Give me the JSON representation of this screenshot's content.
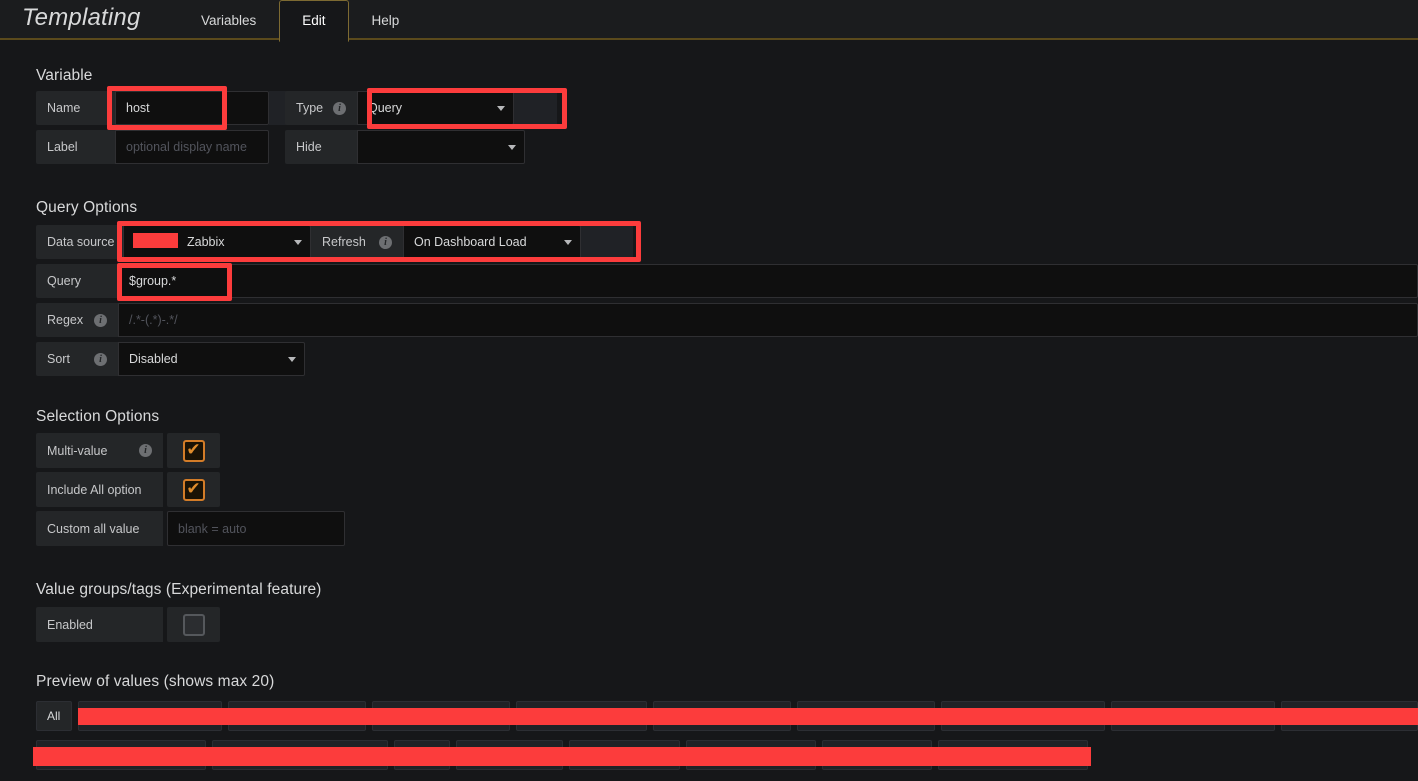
{
  "header": {
    "title": "Templating",
    "tabs": [
      {
        "label": "Variables",
        "active": false
      },
      {
        "label": "Edit",
        "active": true
      },
      {
        "label": "Help",
        "active": false
      }
    ]
  },
  "variable_section": {
    "title": "Variable",
    "name_label": "Name",
    "name_value": "host",
    "type_label": "Type",
    "type_value": "Query",
    "label_label": "Label",
    "label_placeholder": "optional display name",
    "hide_label": "Hide",
    "hide_value": ""
  },
  "query_options": {
    "title": "Query Options",
    "data_source_label": "Data source",
    "data_source_value": "Zabbix",
    "refresh_label": "Refresh",
    "refresh_value": "On Dashboard Load",
    "query_label": "Query",
    "query_value": "$group.*",
    "regex_label": "Regex",
    "regex_placeholder": "/.*-(.*)-.*/",
    "sort_label": "Sort",
    "sort_value": "Disabled"
  },
  "selection_options": {
    "title": "Selection Options",
    "multi_value_label": "Multi-value",
    "multi_value_checked": true,
    "include_all_label": "Include All option",
    "include_all_checked": true,
    "custom_all_label": "Custom all value",
    "custom_all_placeholder": "blank = auto"
  },
  "value_groups": {
    "title": "Value groups/tags (Experimental feature)",
    "enabled_label": "Enabled",
    "enabled_checked": false
  },
  "preview": {
    "title": "Preview of values (shows max 20)",
    "all_label": "All",
    "row1": [
      "",
      "",
      "",
      "",
      "",
      "",
      "",
      "",
      ""
    ],
    "row2": [
      "",
      "",
      "",
      "",
      "",
      "",
      "",
      ""
    ]
  },
  "icons": {
    "info": "i",
    "check": "✔",
    "caret": "caret-down-icon"
  },
  "colors": {
    "annotation_red": "#fc3c3c",
    "accent_orange": "#d37c28",
    "tab_border": "#7d6a32",
    "page_bg": "#161719",
    "panel_bg": "#242628",
    "input_bg": "#0f0f0f"
  }
}
